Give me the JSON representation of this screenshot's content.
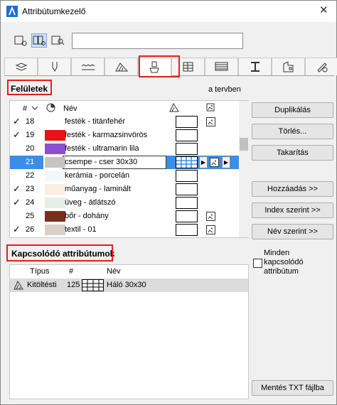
{
  "window": {
    "title": "Attribútumkezelő",
    "close": "✕"
  },
  "toolbar": {
    "buttons": [
      {
        "name": "view-list-icon"
      },
      {
        "name": "view-split-icon",
        "active": true
      },
      {
        "name": "view-search-icon"
      }
    ],
    "search": {
      "value": "",
      "placeholder": ""
    }
  },
  "tabs": [
    {
      "name": "layers-tab-icon"
    },
    {
      "name": "pen-tab-icon"
    },
    {
      "name": "line-tab-icon"
    },
    {
      "name": "fill-tab-icon"
    },
    {
      "name": "surface-tab-icon",
      "active": true
    },
    {
      "name": "composite-tab-icon"
    },
    {
      "name": "profile-tab-icon"
    },
    {
      "name": "column-tab-icon"
    },
    {
      "name": "building-material-tab-icon"
    },
    {
      "name": "pencil-tab-icon"
    }
  ],
  "surfaces": {
    "label": "Felületek",
    "in_project": "a tervben",
    "col_hash": "#",
    "col_name": "Név",
    "rows": [
      {
        "check": "✓",
        "num": "18",
        "color": "#ffffff",
        "name": "festék - titánfehér",
        "pattern": "none",
        "texture": true
      },
      {
        "check": "✓",
        "num": "19",
        "color": "#ee1111",
        "name": "festék - karmazsinvörös",
        "pattern": "none",
        "texture": false
      },
      {
        "check": "",
        "num": "20",
        "color": "#8e4fcf",
        "name": "festék - ultramarin lila",
        "pattern": "none",
        "texture": false
      },
      {
        "check": "",
        "num": "21",
        "color": "#c8c4c0",
        "name": "csempe - cser 30x30",
        "pattern": "grid",
        "texture": true,
        "selected": true
      },
      {
        "check": "",
        "num": "22",
        "color": "#f2f7fb",
        "name": "kerámia - porcelán",
        "pattern": "none",
        "texture": false
      },
      {
        "check": "✓",
        "num": "23",
        "color": "#fbeee1",
        "name": "műanyag - laminált",
        "pattern": "none",
        "texture": false
      },
      {
        "check": "✓",
        "num": "24",
        "color": "#e6eee8",
        "name": "üveg - átlátszó",
        "pattern": "none",
        "texture": false
      },
      {
        "check": "",
        "num": "25",
        "color": "#7b2e1c",
        "name": "bőr - dohány",
        "pattern": "none",
        "texture": true
      },
      {
        "check": "✓",
        "num": "26",
        "color": "#d8cfc8",
        "name": "textil - 01",
        "pattern": "none",
        "texture": true
      }
    ]
  },
  "buttons": {
    "duplicate": "Duplikálás",
    "delete": "Törlés...",
    "purge": "Takarítás",
    "add": "Hozzáadás >>",
    "by_index": "Index szerint >>",
    "by_name": "Név szerint >>",
    "save_txt": "Mentés TXT fájlba"
  },
  "related": {
    "label": "Kapcsolódó attribútumok",
    "col_type": "Típus",
    "col_hash": "#",
    "col_name": "Név",
    "rows": [
      {
        "type": "Kitöltésti",
        "num": "125",
        "name": "Háló 30x30"
      }
    ],
    "all_related_label": "Minden kapcsolódó attribútum",
    "all_related_checked": false
  },
  "colors": {
    "highlight": "#3a8ee6",
    "callout": "#e02020"
  }
}
